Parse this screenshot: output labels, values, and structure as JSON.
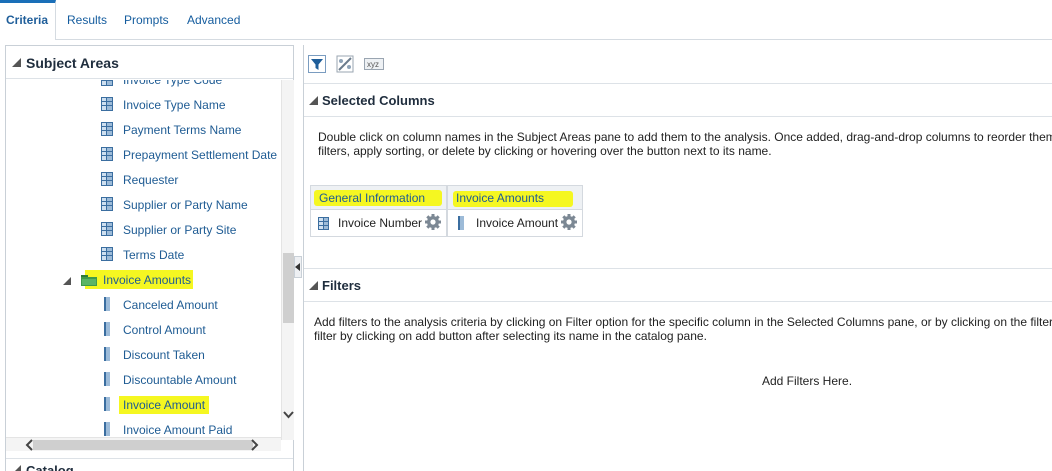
{
  "tabs": [
    {
      "label": "Criteria",
      "active": true
    },
    {
      "label": "Results",
      "active": false
    },
    {
      "label": "Prompts",
      "active": false
    },
    {
      "label": "Advanced",
      "active": false
    }
  ],
  "subject_areas": {
    "title": "Subject Areas",
    "tree": [
      {
        "label": "Invoice Type Code",
        "type": "attribute"
      },
      {
        "label": "Invoice Type Name",
        "type": "attribute"
      },
      {
        "label": "Payment Terms Name",
        "type": "attribute"
      },
      {
        "label": "Prepayment Settlement Date",
        "type": "attribute"
      },
      {
        "label": "Requester",
        "type": "attribute"
      },
      {
        "label": "Supplier or Party Name",
        "type": "attribute"
      },
      {
        "label": "Supplier or Party Site",
        "type": "attribute"
      },
      {
        "label": "Terms Date",
        "type": "attribute"
      },
      {
        "label": "Invoice Amounts",
        "type": "folder",
        "highlighted": true
      },
      {
        "label": "Canceled Amount",
        "type": "measure"
      },
      {
        "label": "Control Amount",
        "type": "measure"
      },
      {
        "label": "Discount Taken",
        "type": "measure"
      },
      {
        "label": "Discountable Amount",
        "type": "measure"
      },
      {
        "label": "Invoice Amount",
        "type": "measure",
        "highlighted": true
      },
      {
        "label": "Invoice Amount Paid",
        "type": "measure"
      }
    ]
  },
  "catalog": {
    "title": "Catalog"
  },
  "toolbar": {
    "icons": [
      "filter-icon",
      "edit-formula-icon",
      "xyz-icon"
    ],
    "xyz_label": "xyz"
  },
  "selected_columns": {
    "title": "Selected Columns",
    "description_line1": "Double click on column names in the Subject Areas pane to add them to the analysis. Once added, drag-and-drop columns to reorder them",
    "description_line2": "filters, apply sorting, or delete by clicking or hovering over the button next to its name.",
    "groups": [
      {
        "header": "General Information",
        "column": "Invoice Number",
        "column_type": "attribute"
      },
      {
        "header": "Invoice Amounts",
        "column": "Invoice Amount",
        "column_type": "measure"
      }
    ]
  },
  "filters": {
    "title": "Filters",
    "description_line1": "Add filters to the analysis criteria by clicking on Filter option for the specific column in the Selected Columns pane, or by clicking on the filter",
    "description_line2": "filter by clicking on add button after selecting its name in the catalog pane.",
    "empty_text": "Add Filters Here."
  },
  "colors": {
    "link": "#1e5b93",
    "highlight": "#f5f721",
    "accent": "#1a6fb8"
  }
}
